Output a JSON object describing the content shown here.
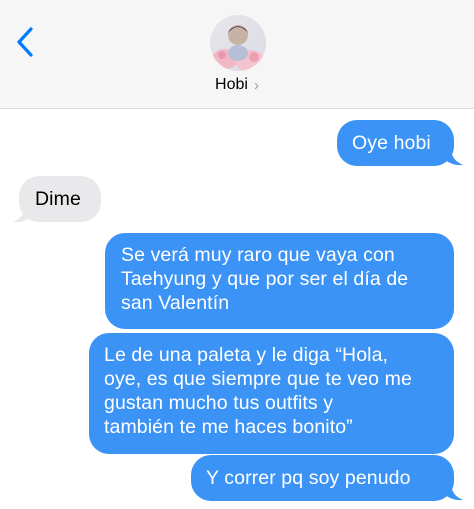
{
  "header": {
    "back_icon": "chevron-left-icon",
    "contact_name": "Hobi",
    "contact_chevron": "›"
  },
  "colors": {
    "sent_bubble": "#3b93f6",
    "received_bubble": "#e9e9eb",
    "accent": "#007aff"
  },
  "messages": [
    {
      "direction": "sent",
      "lines": [
        "Oye hobi"
      ]
    },
    {
      "direction": "received",
      "lines": [
        "Dime"
      ]
    },
    {
      "direction": "sent",
      "lines": [
        "Se verá muy raro que vaya con",
        "Taehyung y que por ser el día de",
        "san Valentín"
      ]
    },
    {
      "direction": "sent",
      "lines": [
        "Le de una paleta y le diga “Hola,",
        "oye, es que siempre que te veo me",
        "gustan mucho tus outfits y",
        "también te me haces bonito”"
      ]
    },
    {
      "direction": "sent",
      "lines": [
        "Y correr pq soy penudo"
      ]
    }
  ]
}
